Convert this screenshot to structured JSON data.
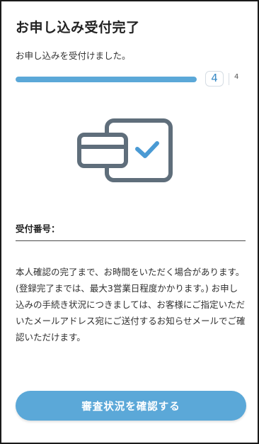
{
  "header": {
    "title": "お申し込み受付完了",
    "subtitle": "お申し込みを受付けました。"
  },
  "progress": {
    "current_step": "4",
    "total_steps": "4",
    "fill_fraction": 1.0,
    "track_color": "#dfe9f2",
    "fill_color": "#5ba8d8"
  },
  "hero": {
    "icon": "card-check-icon",
    "stroke_color": "#5f6e7b",
    "check_color": "#4a9ad4"
  },
  "reception": {
    "label": "受付番号："
  },
  "notice": {
    "text": "本人確認の完了まで、お時間をいただく場合があります。(登録完了までは、最大3営業日程度かかります。) お申し込みの手続き状況につきましては、お客様にご指定いただいたメールアドレス宛にご送付するお知らせメールでご確認いただけます。"
  },
  "actions": {
    "check_status_label": "審査状況を確認する",
    "button_color": "#5ba8d8"
  }
}
